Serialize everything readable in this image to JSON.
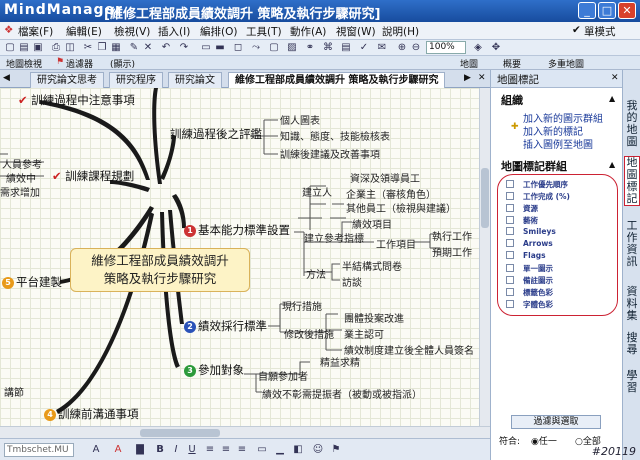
{
  "title_bar": {
    "logo": "MindManager",
    "title": "[維修工程部成員績效調升 策略及執行步驟研究]"
  },
  "menu": [
    "檔案(F)",
    "編輯(E)",
    "檢視(V)",
    "插入(I)",
    "編排(O)",
    "工具(T)",
    "動作(A)",
    "視窗(W)",
    "說明(H)"
  ],
  "menu_right": "單模式",
  "toolbar": {
    "zoom": "100%"
  },
  "toolbar2": {
    "map_view": "地圖檢視",
    "filter": "過濾器",
    "level": "(顯示)",
    "right": [
      "地圖",
      "概要",
      "多重地圖"
    ]
  },
  "tabs": [
    "研究論文思考",
    "研究程序",
    "研究論文",
    "維修工程部成員績效調升 策略及執行步驟研究"
  ],
  "map": {
    "central": [
      "維修工程部成員績效調升",
      "策略及執行步驟研究"
    ],
    "topics": {
      "t_train_issue": "訓練過程中注意事項",
      "t_train_eval": "訓練過程後之評鑑",
      "t_train_plan": "訓練課程規劃",
      "t_basic": "基本能力標準設置",
      "t_platform": "平台建製",
      "t_perf": "績效採行標準",
      "t_participant": "參加對象",
      "t_precomm": "訓練前溝通事項"
    },
    "labels": {
      "l_personal": "個人圖表",
      "l_knowledge": "知識、態度、技能檢核表",
      "l_suggest": "訓練後建議及改善事項",
      "l_ref": "人員參考",
      "l_perf_mid": "績效中",
      "l_req": "需求增加",
      "l_build": "建立人",
      "l_senior": "資深及領導員工",
      "l_enterprise": "企業主（審核角色）",
      "l_other": "其他員工（檢視與建議）",
      "l_perf_ref": "建立參考指標",
      "l_perf_item": "績效項目",
      "l_work_item": "工作項目",
      "l_exec_work": "執行工作",
      "l_expect_work": "預期工作",
      "l_method": "方法",
      "l_semi": "半結構式問卷",
      "l_interview": "訪談",
      "l_existing": "現行措施",
      "l_improve": "修改後措施",
      "l_team": "團體投案改進",
      "l_cert": "業主認可",
      "l_sign": "績效制度建立後全體人員簽名",
      "l_self": "自願參加者",
      "l_seek": "精益求精",
      "l_lowperf": "績效不彰需提振者（被動或被指派）",
      "l_lecture": "講節"
    }
  },
  "panel": {
    "header": "地圖標記",
    "org_title": "組織",
    "links": [
      "加入新的圖示群組",
      "加入新的標記",
      "插入圖例至地圖"
    ],
    "group_title": "地圖標記群組",
    "groups": [
      "工作優先順序",
      "工作完成 (%)",
      "資源",
      "藝術",
      "Smileys",
      "Arrows",
      "Flags",
      "單一圖示",
      "備註圖示",
      "標籤色彩",
      "字體色彩"
    ],
    "filter_btn": "過濾與選取",
    "match_label": "符合:",
    "match_any": "任一",
    "match_all": "全部"
  },
  "side_tabs": [
    "我的地圖",
    "地圖標記",
    "工作資訊",
    "資料集",
    "搜尋",
    "學習"
  ],
  "status": {
    "font": "Tmbschet.MU"
  },
  "watermark": "#20119"
}
